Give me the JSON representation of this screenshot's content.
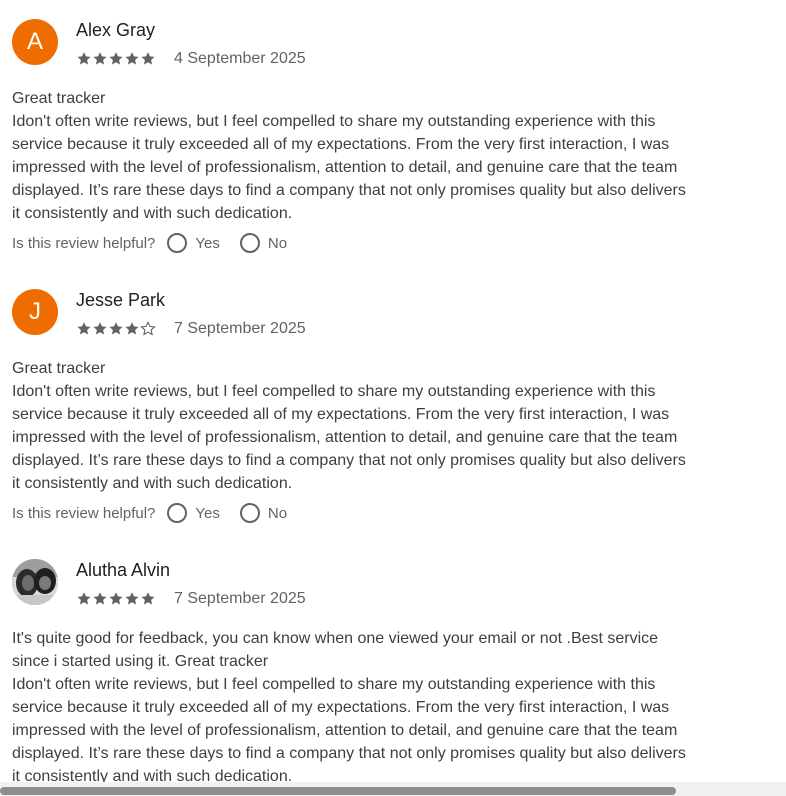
{
  "reviews": [
    {
      "initial": "A",
      "author": "Alex Gray",
      "rating": 5,
      "date": "4 September 2025",
      "extra": "",
      "title": "Great tracker",
      "text": "Idon't often write reviews, but I feel compelled to share my outstanding experience with this service because it truly exceeded all of my expectations. From the very first interaction, I was impressed with the level of professionalism, attention to detail, and genuine care that the team displayed. It’s rare these days to find a company that not only promises quality but also delivers it consistently and with such dedication.",
      "helpful_question": "Is this review helpful?",
      "yes_label": "Yes",
      "no_label": "No"
    },
    {
      "initial": "J",
      "author": "Jesse Park",
      "rating": 4,
      "date": "7 September 2025",
      "extra": "",
      "title": "Great tracker",
      "text": "Idon't often write reviews, but I feel compelled to share my outstanding experience with this service because it truly exceeded all of my expectations. From the very first interaction, I was impressed with the level of professionalism, attention to detail, and genuine care that the team displayed. It’s rare these days to find a company that not only promises quality but also delivers it consistently and with such dedication.",
      "helpful_question": "Is this review helpful?",
      "yes_label": "Yes",
      "no_label": "No"
    },
    {
      "initial": "",
      "author": "Alutha Alvin",
      "rating": 5,
      "date": "7 September 2025",
      "extra": "It's quite good for feedback, you can know when one viewed your email or not .Best service since i started using it. Great tracker",
      "title": "",
      "text": "Idon't often write reviews, but I feel compelled to share my outstanding experience with this service because it truly exceeded all of my expectations. From the very first interaction, I was impressed with the level of professionalism, attention to detail, and genuine care that the team displayed. It’s rare these days to find a company that not only promises quality but also delivers it consistently and with such dedication."
    }
  ],
  "colors": {
    "avatar": "#ef6c00",
    "star": "#5f6368",
    "text": "#3c4043"
  },
  "icons": {
    "star_full": "star-icon",
    "star_empty": "star-outline-icon",
    "radio": "radio-unchecked-icon"
  }
}
